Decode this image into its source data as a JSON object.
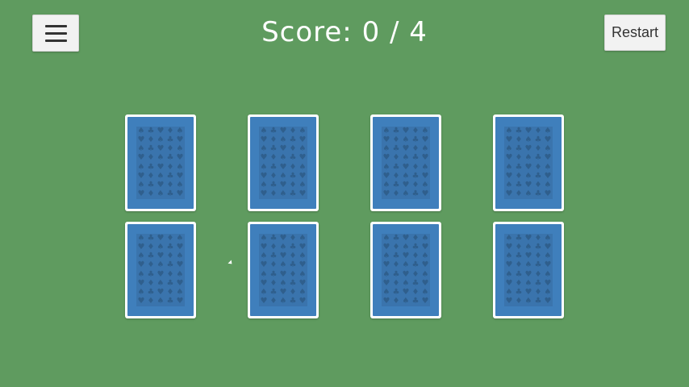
{
  "header": {
    "menu_icon": "hamburger-menu-icon",
    "score_label": "Score: 0 / 4",
    "restart_label": "Restart"
  },
  "colors": {
    "table": "#5f9b5f",
    "card_back": "#3f7fbc",
    "card_border": "#ffffff"
  },
  "board": {
    "rows": 2,
    "columns": 4,
    "cards": [
      {
        "state": "face-down"
      },
      {
        "state": "face-down"
      },
      {
        "state": "face-down"
      },
      {
        "state": "face-down"
      },
      {
        "state": "face-down"
      },
      {
        "state": "face-down"
      },
      {
        "state": "face-down"
      },
      {
        "state": "face-down"
      }
    ],
    "back_pattern_icon": "card-suit-pattern-icon"
  }
}
